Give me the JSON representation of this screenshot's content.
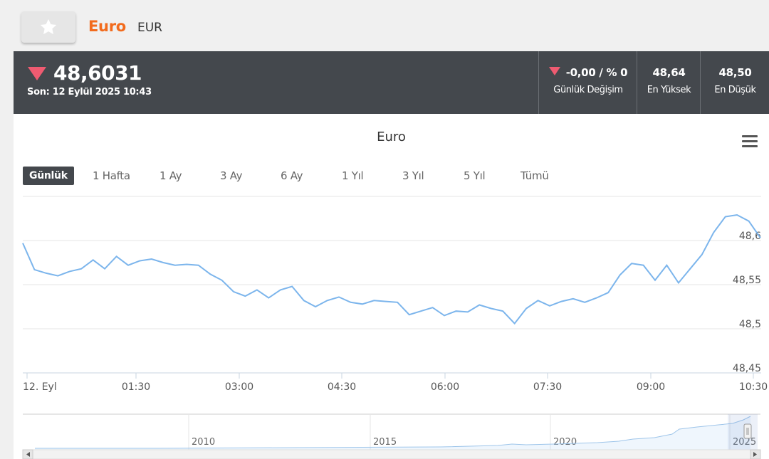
{
  "header": {
    "favorite_icon": "star-icon",
    "name": "Euro",
    "code": "EUR"
  },
  "price": {
    "direction_icon": "triangle-down-icon",
    "value": "48,6031",
    "updated": "Son: 12 Eylül 2025 10:43",
    "change_value": "-0,00 / % 0",
    "change_label": "Günlük Değişim",
    "high_value": "48,64",
    "high_label": "En Yüksek",
    "low_value": "48,50",
    "low_label": "En Düşük",
    "down_color": "#ef5b71"
  },
  "chart": {
    "title": "Euro",
    "menu_icon": "hamburger-menu-icon",
    "ranges": [
      {
        "label": "Günlük",
        "active": true
      },
      {
        "label": "1 Hafta",
        "active": false
      },
      {
        "label": "1 Ay",
        "active": false
      },
      {
        "label": "3 Ay",
        "active": false
      },
      {
        "label": "6 Ay",
        "active": false
      },
      {
        "label": "1 Yıl",
        "active": false
      },
      {
        "label": "3 Yıl",
        "active": false
      },
      {
        "label": "5 Yıl",
        "active": false
      },
      {
        "label": "Tümü",
        "active": false
      }
    ],
    "navigator_labels": [
      "2010",
      "2015",
      "2020",
      "2025"
    ],
    "line_color": "#7cb5ec"
  },
  "chart_data": {
    "type": "line",
    "title": "Euro",
    "x_ticks": [
      "12. Eyl",
      "01:30",
      "03:00",
      "04:30",
      "06:00",
      "07:30",
      "09:00",
      "10:30"
    ],
    "y_ticks": [
      "48,45",
      "48,5",
      "48,55",
      "48,6"
    ],
    "ylim": [
      48.45,
      48.65
    ],
    "grid": true,
    "series": [
      {
        "values": [
          48.597,
          48.567,
          48.563,
          48.56,
          48.565,
          48.568,
          48.578,
          48.568,
          48.582,
          48.572,
          48.577,
          48.579,
          48.575,
          48.572,
          48.573,
          48.572,
          48.562,
          48.555,
          48.542,
          48.537,
          48.544,
          48.535,
          48.544,
          48.548,
          48.532,
          48.525,
          48.532,
          48.536,
          48.53,
          48.528,
          48.532,
          48.531,
          48.53,
          48.516,
          48.52,
          48.524,
          48.515,
          48.52,
          48.519,
          48.527,
          48.523,
          48.52,
          48.506,
          48.523,
          48.532,
          48.526,
          48.531,
          48.534,
          48.53,
          48.535,
          48.541,
          48.561,
          48.574,
          48.572,
          48.555,
          48.572,
          48.552,
          48.568,
          48.584,
          48.609,
          48.627,
          48.629,
          48.622,
          48.603
        ]
      }
    ]
  }
}
